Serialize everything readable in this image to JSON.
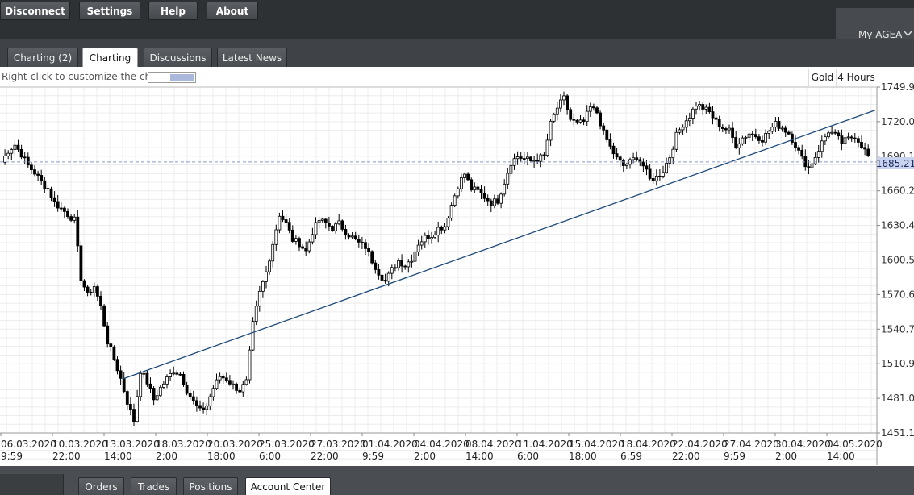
{
  "toolbar": {
    "disconnect": "Disconnect",
    "settings": "Settings",
    "help": "Help",
    "about": "About"
  },
  "user": {
    "name": "My AGEA",
    "chevron_icon": "chevron-down-icon"
  },
  "tabs": [
    {
      "label": "Charting (2)",
      "active": false
    },
    {
      "label": "Charting",
      "active": true
    },
    {
      "label": "Discussions",
      "active": false
    },
    {
      "label": "Latest News",
      "active": false
    }
  ],
  "chart_header": {
    "hint": "Right-click to customize the chart",
    "instrument": "Gold",
    "timeframe": "4 Hours"
  },
  "bottom_tabs": [
    {
      "label": "Orders",
      "active": false
    },
    {
      "label": "Trades",
      "active": false
    },
    {
      "label": "Positions",
      "active": false
    },
    {
      "label": "Account Center",
      "active": true
    }
  ],
  "colors": {
    "toolbar_bg": "#2e3134",
    "tab_bar_bg": "#3f4347",
    "chart_bg": "#ffffff",
    "grid": "#ececec",
    "candle": "#000000",
    "trendline": "#1e4a7a",
    "current_price_badge": "#c9d3f0",
    "current_price_line": "#8a96c8"
  },
  "chart_data": {
    "type": "candlestick",
    "instrument": "Gold",
    "timeframe": "4 Hours",
    "current_price": "1685.21",
    "y_ticks": [
      "1749.92",
      "1720.04",
      "1690.17",
      "1660.29",
      "1630.42",
      "1600.54",
      "1570.67",
      "1540.79",
      "1510.92",
      "1481.04",
      "1451.17"
    ],
    "ylim": [
      1451.17,
      1749.92
    ],
    "x_tick_labels": [
      [
        "06.03.2020",
        "9:59"
      ],
      [
        "10.03.2020",
        "22:00"
      ],
      [
        "13.03.2020",
        "14:00"
      ],
      [
        "18.03.2020",
        "2:00"
      ],
      [
        "20.03.2020",
        "18:00"
      ],
      [
        "25.03.2020",
        "6:00"
      ],
      [
        "27.03.2020",
        "22:00"
      ],
      [
        "01.04.2020",
        "9:59"
      ],
      [
        "04.04.2020",
        "2:00"
      ],
      [
        "08.04.2020",
        "14:00"
      ],
      [
        "11.04.2020",
        "6:00"
      ],
      [
        "15.04.2020",
        "18:00"
      ],
      [
        "18.04.2020",
        "6:59"
      ],
      [
        "22.04.2020",
        "22:00"
      ],
      [
        "27.04.2020",
        "9:59"
      ],
      [
        "30.04.2020",
        "2:00"
      ],
      [
        "04.05.2020",
        "14:00"
      ]
    ],
    "close_path": [
      1685,
      1695,
      1700,
      1692,
      1682,
      1676,
      1668,
      1662,
      1650,
      1645,
      1640,
      1635,
      1585,
      1570,
      1578,
      1560,
      1530,
      1515,
      1498,
      1478,
      1462,
      1505,
      1495,
      1480,
      1490,
      1498,
      1505,
      1502,
      1488,
      1478,
      1470,
      1475,
      1490,
      1500,
      1498,
      1492,
      1488,
      1495,
      1545,
      1572,
      1590,
      1615,
      1640,
      1632,
      1618,
      1615,
      1608,
      1625,
      1635,
      1632,
      1628,
      1632,
      1625,
      1620,
      1615,
      1612,
      1600,
      1590,
      1582,
      1592,
      1600,
      1596,
      1602,
      1615,
      1620,
      1622,
      1628,
      1630,
      1648,
      1665,
      1675,
      1662,
      1660,
      1655,
      1650,
      1652,
      1668,
      1685,
      1690,
      1688,
      1686,
      1688,
      1690,
      1718,
      1732,
      1740,
      1722,
      1718,
      1720,
      1732,
      1728,
      1710,
      1698,
      1688,
      1682,
      1685,
      1690,
      1682,
      1670,
      1672,
      1678,
      1690,
      1708,
      1718,
      1725,
      1735,
      1732,
      1728,
      1720,
      1715,
      1712,
      1700,
      1706,
      1710,
      1708,
      1705,
      1712,
      1718,
      1715,
      1710,
      1700,
      1688,
      1680,
      1690,
      1702,
      1712,
      1708,
      1702,
      1705,
      1708,
      1700,
      1690
    ],
    "trendline": {
      "from": [
        "18.03.2020 2:00",
        1498
      ],
      "to": [
        "04.05.2020 14:00",
        1730
      ]
    }
  }
}
